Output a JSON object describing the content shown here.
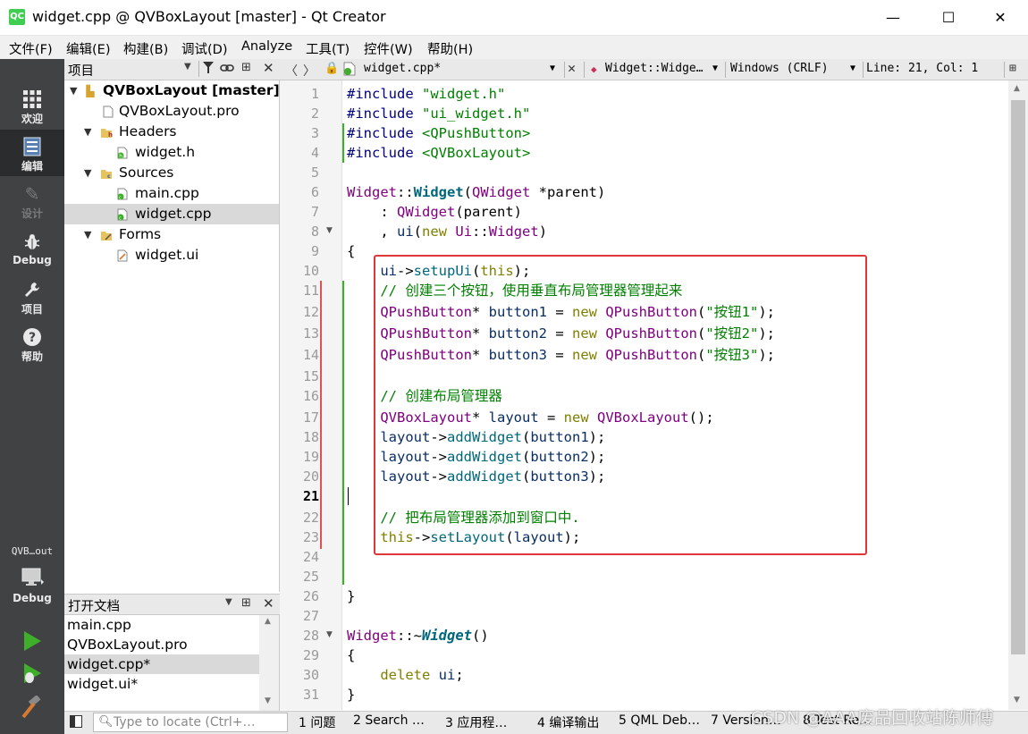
{
  "window": {
    "title": "widget.cpp @ QVBoxLayout [master] - Qt Creator",
    "app_icon_text": "QC",
    "minimize": "—",
    "maximize": "☐",
    "close": "✕"
  },
  "menu": [
    "文件(F)",
    "编辑(E)",
    "构建(B)",
    "调试(D)",
    "Analyze",
    "工具(T)",
    "控件(W)",
    "帮助(H)"
  ],
  "modes": [
    {
      "label": "欢迎",
      "icon": "grid-icon"
    },
    {
      "label": "编辑",
      "icon": "document-icon"
    },
    {
      "label": "设计",
      "icon": "pencil-icon"
    },
    {
      "label": "Debug",
      "icon": "bug-icon"
    },
    {
      "label": "项目",
      "icon": "wrench-icon"
    },
    {
      "label": "帮助",
      "icon": "question-icon"
    }
  ],
  "kit": {
    "project": "QVB…out",
    "config": "Debug"
  },
  "project_pane": {
    "title": "项目",
    "tree": [
      {
        "label": "QVBoxLayout [master]",
        "bold": true
      },
      {
        "label": "QVBoxLayout.pro"
      },
      {
        "label": "Headers"
      },
      {
        "label": "widget.h"
      },
      {
        "label": "Sources"
      },
      {
        "label": "main.cpp"
      },
      {
        "label": "widget.cpp",
        "selected": true
      },
      {
        "label": "Forms"
      },
      {
        "label": "widget.ui"
      }
    ]
  },
  "open_docs": {
    "title": "打开文档",
    "items": [
      "main.cpp",
      "QVBoxLayout.pro",
      "widget.cpp*",
      "widget.ui*"
    ],
    "selected_index": 2
  },
  "editor_toolbar": {
    "file": "widget.cpp*",
    "symbol": "Widget::Widge…",
    "line_ending": "Windows (CRLF)",
    "position": "Line: 21, Col: 1"
  },
  "editor": {
    "current_line": 21,
    "line_numbers": [
      "1",
      "2",
      "3",
      "4",
      "5",
      "6",
      "7",
      "8",
      "9",
      "10",
      "11",
      "12",
      "13",
      "14",
      "15",
      "16",
      "17",
      "18",
      "19",
      "20",
      "21",
      "22",
      "23",
      "24",
      "25",
      "26",
      "27",
      "28",
      "29",
      "30",
      "31"
    ],
    "code": {
      "l1_pp": "#include",
      "l1_str": "\"widget.h\"",
      "l2_pp": "#include",
      "l2_str": "\"ui_widget.h\"",
      "l3_pp": "#include",
      "l3_str": "<QPushButton>",
      "l4_pp": "#include",
      "l4_str": "<QVBoxLayout>",
      "l6_a": "Widget",
      "l6_b": "::",
      "l6_c": "Widget",
      "l6_d": "(",
      "l6_e": "QWidget",
      "l6_f": " *",
      "l6_g": "parent",
      "l6_h": ")",
      "l7_a": "    : ",
      "l7_b": "QWidget",
      "l7_c": "(",
      "l7_d": "parent",
      "l7_e": ")",
      "l8_a": "    , ",
      "l8_b": "ui",
      "l8_c": "(",
      "l8_d": "new",
      "l8_e": " ",
      "l8_f": "Ui",
      "l8_g": "::",
      "l8_h": "Widget",
      "l8_i": ")",
      "l9": "{",
      "l10_a": "    ",
      "l10_b": "ui",
      "l10_c": "->",
      "l10_d": "setupUi",
      "l10_e": "(",
      "l10_f": "this",
      "l10_g": ");",
      "l11": "    // 创建三个按钮，使用垂直布局管理器管理起来",
      "l12_a": "    ",
      "l12_b": "QPushButton",
      "l12_c": "* ",
      "l12_d": "button1",
      "l12_e": " = ",
      "l12_f": "new",
      "l12_g": " ",
      "l12_h": "QPushButton",
      "l12_i": "(",
      "l12_j": "\"按钮1\"",
      "l12_k": ");",
      "l13_a": "    ",
      "l13_b": "QPushButton",
      "l13_c": "* ",
      "l13_d": "button2",
      "l13_e": " = ",
      "l13_f": "new",
      "l13_g": " ",
      "l13_h": "QPushButton",
      "l13_i": "(",
      "l13_j": "\"按钮2\"",
      "l13_k": ");",
      "l14_a": "    ",
      "l14_b": "QPushButton",
      "l14_c": "* ",
      "l14_d": "button3",
      "l14_e": " = ",
      "l14_f": "new",
      "l14_g": " ",
      "l14_h": "QPushButton",
      "l14_i": "(",
      "l14_j": "\"按钮3\"",
      "l14_k": ");",
      "l16": "    // 创建布局管理器",
      "l17_a": "    ",
      "l17_b": "QVBoxLayout",
      "l17_c": "* ",
      "l17_d": "layout",
      "l17_e": " = ",
      "l17_f": "new",
      "l17_g": " ",
      "l17_h": "QVBoxLayout",
      "l17_i": "();",
      "l18_a": "    ",
      "l18_b": "layout",
      "l18_c": "->",
      "l18_d": "addWidget",
      "l18_e": "(",
      "l18_f": "button1",
      "l18_g": ");",
      "l19_a": "    ",
      "l19_b": "layout",
      "l19_c": "->",
      "l19_d": "addWidget",
      "l19_e": "(",
      "l19_f": "button2",
      "l19_g": ");",
      "l20_a": "    ",
      "l20_b": "layout",
      "l20_c": "->",
      "l20_d": "addWidget",
      "l20_e": "(",
      "l20_f": "button3",
      "l20_g": ");",
      "l22": "    // 把布局管理器添加到窗口中.",
      "l23_a": "    ",
      "l23_b": "this",
      "l23_c": "->",
      "l23_d": "setLayout",
      "l23_e": "(",
      "l23_f": "layout",
      "l23_g": ");",
      "l26": "}",
      "l28_a": "Widget",
      "l28_b": "::~",
      "l28_c": "Widget",
      "l28_d": "()",
      "l29": "{",
      "l30_a": "    ",
      "l30_b": "delete",
      "l30_c": " ",
      "l30_d": "ui",
      "l30_e": ";",
      "l31": "}"
    }
  },
  "status": {
    "locate_placeholder": "Type to locate (Ctrl+…",
    "tabs": [
      "1 问题",
      "2 Search …",
      "3 应用程…",
      "4 编译输出",
      "5 QML Deb…",
      "7 Version…",
      "8 Test Re…"
    ]
  },
  "watermark": "CSDN @AAA废品回收站陈师傅",
  "colors": {
    "modebar": "#404244",
    "highlight_box": "#e0383a",
    "keyword": "#808000",
    "type": "#800080",
    "string": "#008000"
  }
}
